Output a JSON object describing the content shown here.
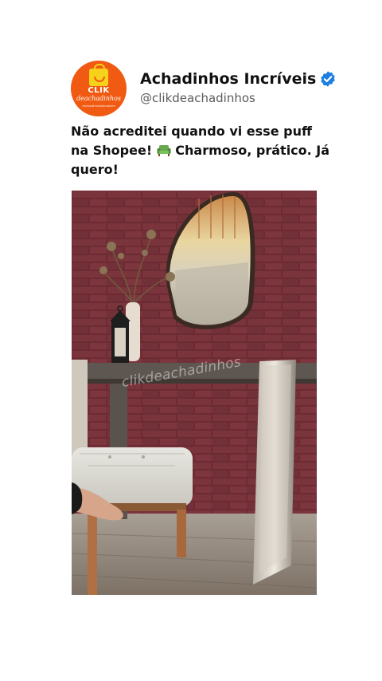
{
  "account": {
    "name": "Achadinhos Incríveis",
    "handle": "@clikdeachadinhos",
    "verified": true,
    "avatar_logo": {
      "line1": "CLIK",
      "line2": "deachadinhos",
      "line3": "#achadinhosdiamantes"
    }
  },
  "post": {
    "caption_before_emoji": "Não acreditei quando vi esse puff na Shopee! ",
    "caption_emoji": "armchair-emoji",
    "caption_after_emoji": " Charmoso, prático. Já quero!"
  },
  "media": {
    "watermark": "clikdeachadinhos"
  },
  "colors": {
    "brand_orange": "#f05a12",
    "verified_blue": "#1d7fe0",
    "brick": "#6e2f35"
  }
}
